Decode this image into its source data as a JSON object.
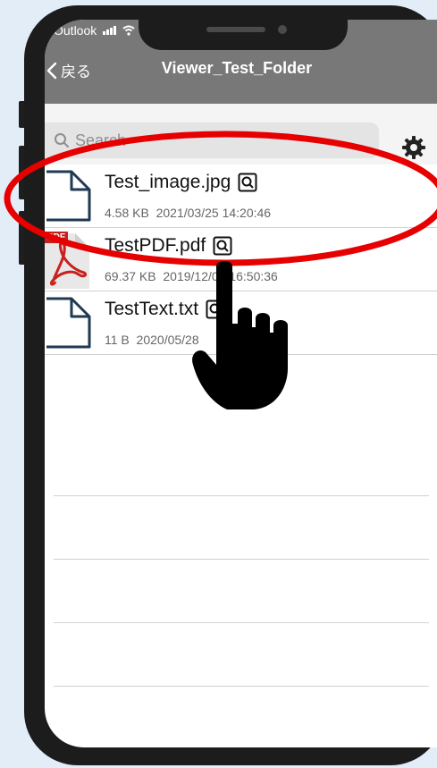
{
  "status_bar": {
    "carrier": "Outlook"
  },
  "nav": {
    "back_label": "戻る",
    "title": "Viewer_Test_Folder"
  },
  "search": {
    "placeholder": "Search"
  },
  "files": [
    {
      "name": "Test_image.jpg",
      "size": "4.58 KB",
      "date": "2021/03/25 14:20:46",
      "icon": "document-icon"
    },
    {
      "name": "TestPDF.pdf",
      "size": "69.37 KB",
      "date": "2019/12/05 16:50:36",
      "icon": "pdf-icon",
      "pdf_badge": "PDF"
    },
    {
      "name": "TestText.txt",
      "size": "11 B",
      "date": "2020/05/28",
      "icon": "document-icon"
    }
  ],
  "annotation": {
    "highlight_color": "#e60000",
    "highlighted_item": "Test_image.jpg",
    "pointer": "hand-pointer-icon"
  }
}
